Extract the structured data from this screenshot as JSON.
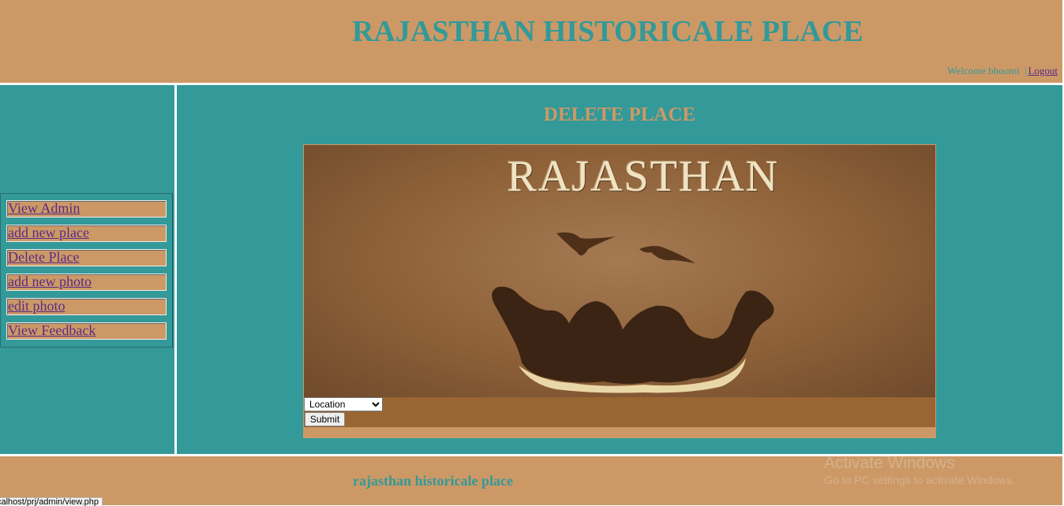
{
  "header": {
    "title": "RAJASTHAN HISTORICALE PLACE",
    "welcome_text": "Welcome bhoomi",
    "separator": "|",
    "logout_label": "Logout"
  },
  "sidebar": {
    "items": [
      {
        "label": "View Admin"
      },
      {
        "label": "add new place"
      },
      {
        "label": "Delete Place"
      },
      {
        "label": "add new photo"
      },
      {
        "label": "edit photo"
      },
      {
        "label": "View Feedback"
      }
    ]
  },
  "main": {
    "heading": "DELETE PLACE",
    "banner": {
      "text": "RAJASTHAN"
    },
    "form": {
      "location_selected": "Location",
      "submit_label": "Submit"
    }
  },
  "footer": {
    "text": "rajasthan historicale place"
  },
  "overlay": {
    "watermark_title": "Activate Windows",
    "watermark_subtitle": "Go to PC settings to activate Windows.",
    "status_url": "calhost/prj/admin/view.php"
  },
  "colors": {
    "tan": "#cc9966",
    "teal": "#339999",
    "brown": "#996633",
    "link": "#5b2a86"
  }
}
